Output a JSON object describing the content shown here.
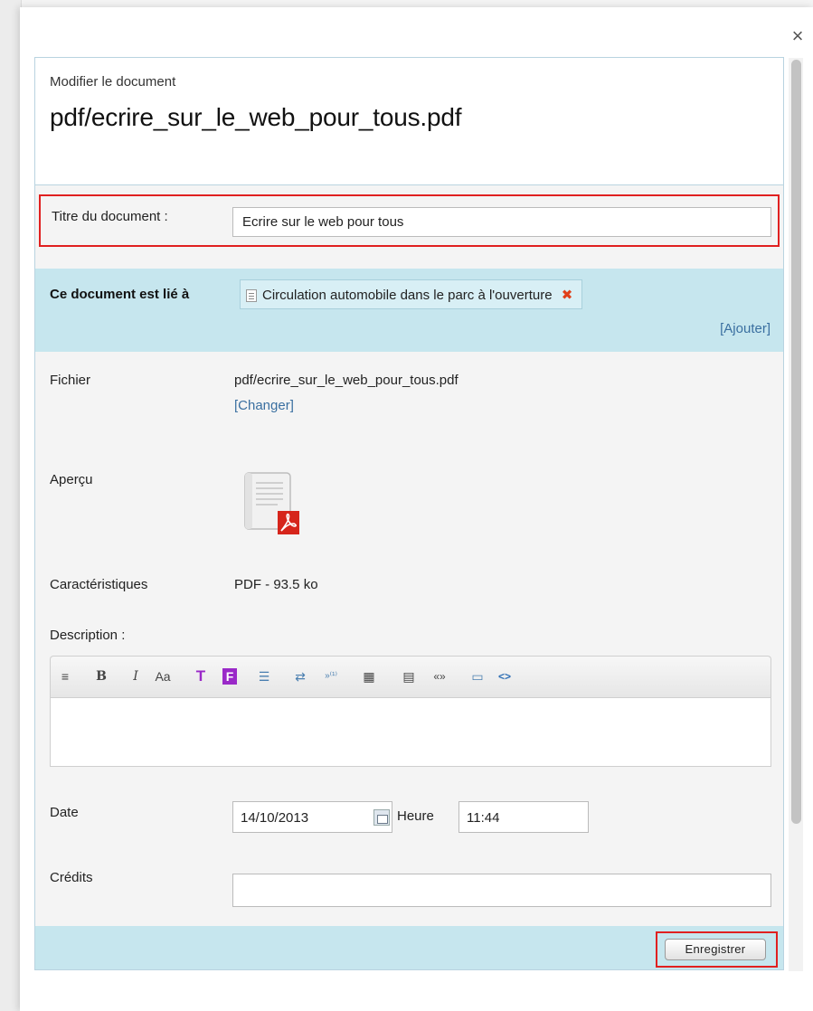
{
  "modal": {
    "close_label": "×",
    "subtitle": "Modifier le document",
    "title": "pdf/ecrire_sur_le_web_pour_tous.pdf"
  },
  "title_field": {
    "label": "Titre du document :",
    "value": "Ecrire sur le web pour tous"
  },
  "linked": {
    "label": "Ce document est lié à",
    "item": "Circulation automobile dans le parc à l'ouverture",
    "remove_label": "✖",
    "add_label": "[Ajouter]"
  },
  "file": {
    "label": "Fichier",
    "value": "pdf/ecrire_sur_le_web_pour_tous.pdf",
    "change_label": "[Changer]"
  },
  "preview": {
    "label": "Aperçu",
    "icon": "pdf-file-icon"
  },
  "characteristics": {
    "label": "Caractéristiques",
    "value": "PDF - 93.5 ko"
  },
  "description": {
    "label": "Description :",
    "toolbar": [
      {
        "name": "intertitle-icon",
        "glyph": "≡"
      },
      {
        "name": "bold-icon",
        "glyph": "B"
      },
      {
        "name": "italic-icon",
        "glyph": "I"
      },
      {
        "name": "font-size-icon",
        "glyph": "Aa"
      },
      {
        "name": "text-color-icon",
        "glyph": "T"
      },
      {
        "name": "background-color-icon",
        "glyph": "F"
      },
      {
        "name": "bullet-list-icon",
        "glyph": "☰"
      },
      {
        "name": "spip-link-icon",
        "glyph": "⇄"
      },
      {
        "name": "footnote-icon",
        "glyph": "»⁽¹⁾"
      },
      {
        "name": "table-icon",
        "glyph": "▦"
      },
      {
        "name": "code-block-icon",
        "glyph": "▤"
      },
      {
        "name": "quote-icon",
        "glyph": "«»"
      },
      {
        "name": "preview-icon",
        "glyph": "▭"
      },
      {
        "name": "source-code-icon",
        "glyph": "<>"
      }
    ],
    "value": ""
  },
  "date": {
    "label": "Date",
    "value": "14/10/2013",
    "time_label": "Heure",
    "time_value": "11:44"
  },
  "credits": {
    "label": "Crédits",
    "value": ""
  },
  "footer": {
    "save_label": "Enregistrer"
  },
  "colors": {
    "highlight_border": "#e02020",
    "section_band": "#c6e6ee",
    "link": "#3a6fa0"
  }
}
